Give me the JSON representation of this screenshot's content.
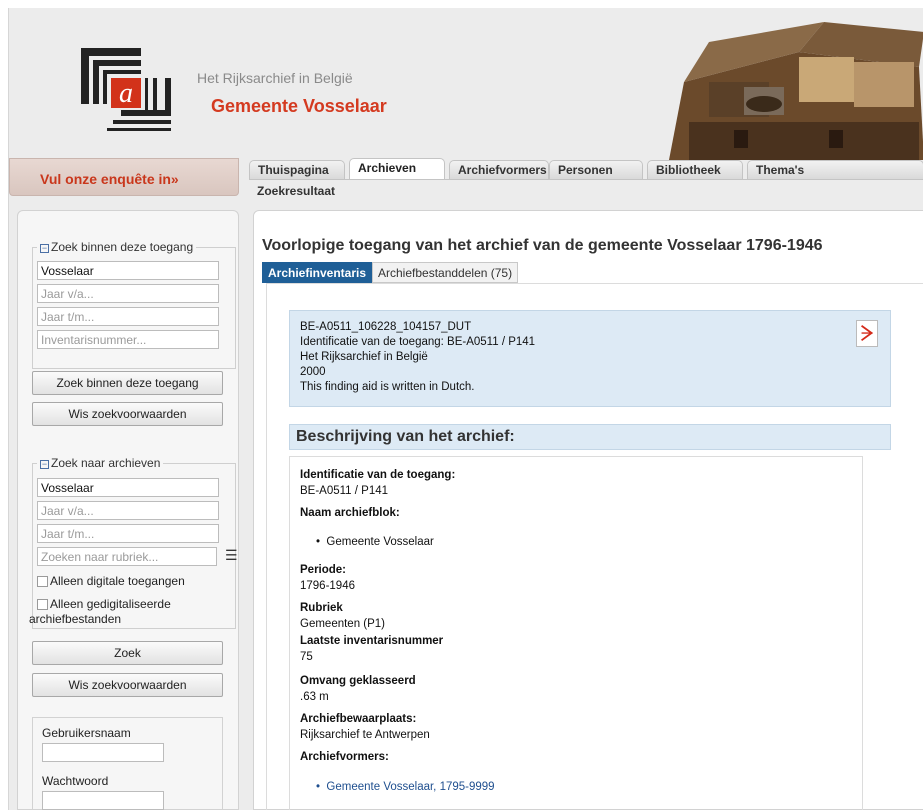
{
  "header": {
    "brand_sub": "Het Rijksarchief in België",
    "brand_main": "Gemeente Vosselaar",
    "logo_icon": "rijksarchief-logo-icon",
    "image": "archive-chest-photo"
  },
  "survey": {
    "label": "Vul onze enquête in»"
  },
  "tabs": [
    {
      "label": "Thuispagina",
      "active": false
    },
    {
      "label": "Archieven",
      "active": true
    },
    {
      "label": "Archiefvormers",
      "active": false
    },
    {
      "label": "Personen",
      "active": false
    },
    {
      "label": "Bibliotheek",
      "active": false
    },
    {
      "label": "Thema's",
      "active": false
    }
  ],
  "breadcrumb": "Zoekresultaat",
  "sidebar": {
    "within": {
      "legend": "Zoek binnen deze toegang",
      "value1": "Vosselaar",
      "ph_from": "Jaar v/a...",
      "ph_to": "Jaar t/m...",
      "ph_inv": "Inventarisnummer...",
      "search_btn": "Zoek binnen deze toegang",
      "clear_btn": "Wis zoekvoorwaarden"
    },
    "archives": {
      "legend": "Zoek naar archieven",
      "value1": "Vosselaar",
      "ph_from": "Jaar v/a...",
      "ph_to": "Jaar t/m...",
      "ph_rubric": "Zoeken naar rubriek...",
      "chk_digital": "Alleen digitale toegangen",
      "chk_digitized_1": "Alleen gedigitaliseerde",
      "chk_digitized_2": "archiefbestanden",
      "search_btn": "Zoek",
      "clear_btn": "Wis zoekvoorwaarden"
    },
    "login": {
      "username_label": "Gebruikersnaam",
      "password_label": "Wachtwoord"
    }
  },
  "main": {
    "title": "Voorlopige toegang van het archief van de gemeente Vosselaar 1796-1946",
    "subtabs": [
      {
        "label": "Archiefinventaris",
        "active": true
      },
      {
        "label": "Archiefbestanddelen (75)",
        "active": false
      }
    ],
    "idbox": [
      "BE-A0511_106228_104157_DUT",
      "Identificatie van de toegang: BE-A0511 / P141",
      "Het Rijksarchief in België",
      "2000",
      "This finding aid is written in Dutch."
    ],
    "section_title": "Beschrijving van het archief:",
    "desc": {
      "id_label": "Identificatie van de toegang:",
      "id_value": "BE-A0511 / P141",
      "block_label": "Naam archiefblok:",
      "block_item": "Gemeente Vosselaar",
      "period_label": "Periode:",
      "period_value": "1796-1946",
      "rubric_label": "Rubriek",
      "rubric_value": "Gemeenten (P1)",
      "last_label": "Laatste inventarisnummer",
      "last_value": "75",
      "extent_label": "Omvang geklasseerd",
      "extent_value": ".63 m",
      "place_label": "Archiefbewaarplaats:",
      "place_value": "Rijksarchief te Antwerpen",
      "creators_label": "Archiefvormers:",
      "creator_item": "Gemeente Vosselaar, 1795-9999"
    }
  }
}
